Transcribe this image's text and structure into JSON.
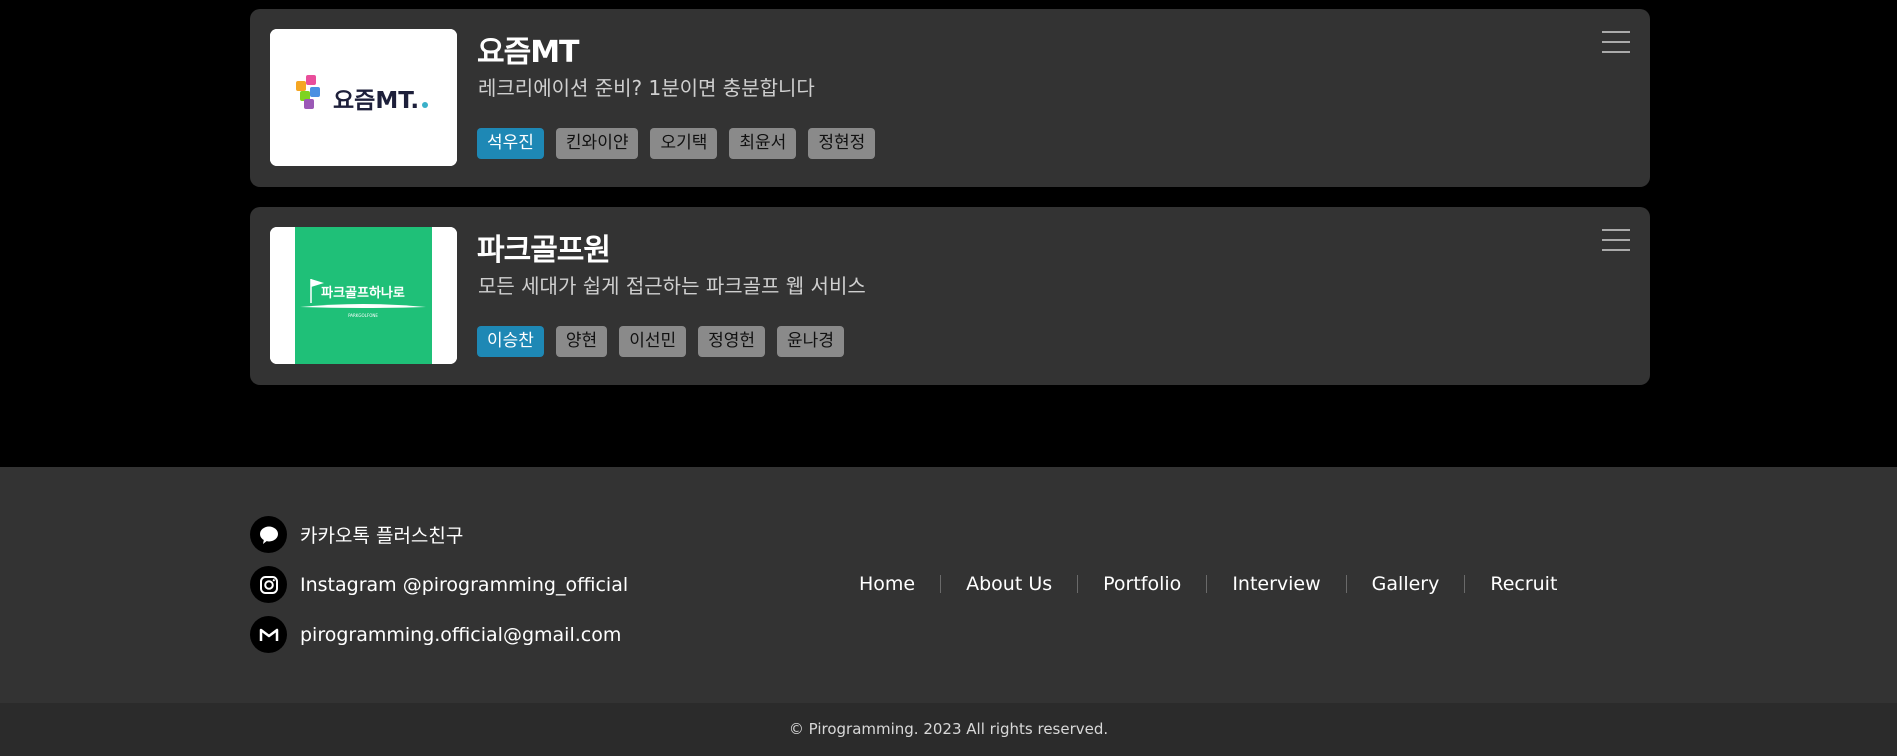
{
  "projects": [
    {
      "title": "요즘MT",
      "description": "레크리에이션 준비? 1분이면 충분합니다",
      "logo_text": "요즘MT.",
      "members": [
        "석우진",
        "킨와이얀",
        "오기택",
        "최윤서",
        "정현정"
      ]
    },
    {
      "title": "파크골프원",
      "description": "모든 세대가 쉽게 접근하는 파크골프 웹 서비스",
      "logo_text": "파크골프하나로",
      "logo_subtext": "PARKGOLFONE",
      "members": [
        "이승찬",
        "양현",
        "이선민",
        "정영헌",
        "윤나경"
      ]
    }
  ],
  "footer": {
    "contacts": {
      "kakao": "카카오톡 플러스친구",
      "instagram": "Instagram @pirogramming_official",
      "email": "pirogramming.official@gmail.com"
    },
    "nav": [
      "Home",
      "About Us",
      "Portfolio",
      "Interview",
      "Gallery",
      "Recruit"
    ],
    "copyright": "© Pirogramming. 2023 All rights reserved."
  },
  "colors": {
    "lead_tag": "#1e88b5",
    "member_tag": "#8a8a8a",
    "card_bg": "#333333",
    "golf_green": "#1fc078"
  },
  "icons": [
    "menu-icon",
    "kakao-talk-icon",
    "instagram-icon",
    "gmail-icon"
  ]
}
